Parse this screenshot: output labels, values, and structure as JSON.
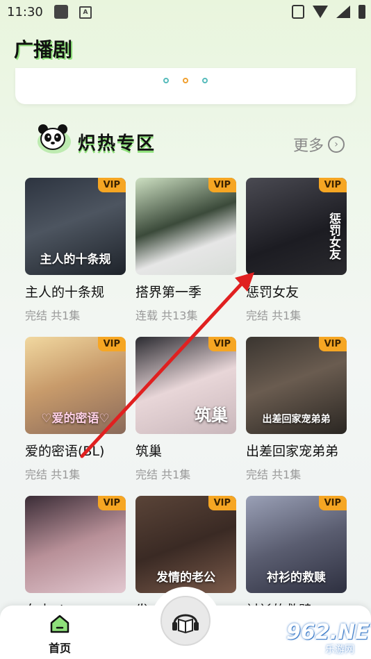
{
  "status_bar": {
    "time": "11:30",
    "input_badge": "A"
  },
  "header": {
    "title": "广播剧"
  },
  "banner": {
    "dot_count": 3,
    "active_dot": 1
  },
  "section": {
    "title": "炽热专区",
    "more_label": "更多"
  },
  "items": [
    {
      "title": "主人的十条规",
      "meta": "完结 共1集",
      "badge": "VIP",
      "cover_text": "主人的十条规"
    },
    {
      "title": "搭界第一季",
      "meta": "连载 共13集",
      "badge": "VIP",
      "cover_text": ""
    },
    {
      "title": "惩罚女友",
      "meta": "完结 共1集",
      "badge": "VIP",
      "cover_text": "惩罚女友"
    },
    {
      "title": "爱的密语(BL)",
      "meta": "完结 共1集",
      "badge": "VIP",
      "cover_text": "♡爱的密语♡"
    },
    {
      "title": "筑巢",
      "meta": "完结 共1集",
      "badge": "VIP",
      "cover_text": "筑巢"
    },
    {
      "title": "出差回家宠弟弟",
      "meta": "完结 共1集",
      "badge": "VIP",
      "cover_text": "出差回家宠弟弟"
    },
    {
      "title": "车内play",
      "meta": "",
      "badge": "VIP",
      "cover_text": ""
    },
    {
      "title": "发",
      "meta": "",
      "badge": "VIP",
      "cover_text": "发情的老公"
    },
    {
      "title": "衬衫的救赎",
      "meta": "",
      "badge": "VIP",
      "cover_text": "衬衫的救赎"
    }
  ],
  "bottom_nav": {
    "home_label": "首页",
    "center_icon": "headphones-book-icon"
  },
  "watermark": {
    "net": "962.NET",
    "sub": "乐游网"
  },
  "colors": {
    "accent_green": "#8ee07a",
    "vip": "#f6a623",
    "arrow": "#e02020"
  }
}
